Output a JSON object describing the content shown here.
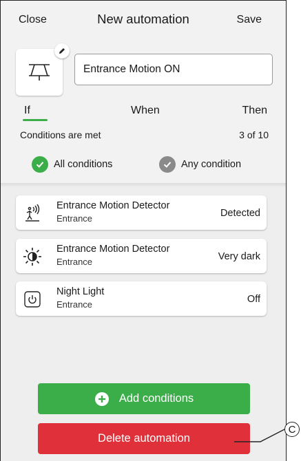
{
  "header": {
    "close_label": "Close",
    "title": "New automation",
    "save_label": "Save"
  },
  "automation": {
    "name": "Entrance Motion ON",
    "icon": "motion-sensor-icon"
  },
  "tabs": [
    {
      "label": "If",
      "active": true
    },
    {
      "label": "When"
    },
    {
      "label": "Then"
    }
  ],
  "conditions": {
    "label": "Conditions are met",
    "count": "3 of 10",
    "options": [
      {
        "label": "All conditions",
        "selected": true
      },
      {
        "label": "Any condition",
        "selected": false
      }
    ]
  },
  "items": [
    {
      "title": "Entrance Motion Detector",
      "room": "Entrance",
      "value": "Detected",
      "icon": "motion-detector-icon"
    },
    {
      "title": "Entrance Motion Detector",
      "room": "Entrance",
      "value": "Very dark",
      "icon": "light-level-icon"
    },
    {
      "title": "Night Light",
      "room": "Entrance",
      "value": "Off",
      "icon": "power-icon"
    }
  ],
  "actions": {
    "add_label": "Add conditions",
    "delete_label": "Delete automation"
  },
  "callout": {
    "label": "C"
  },
  "colors": {
    "accent_green": "#3cae49",
    "danger_red": "#e0303a",
    "unselected_gray": "#8a8a8a"
  }
}
